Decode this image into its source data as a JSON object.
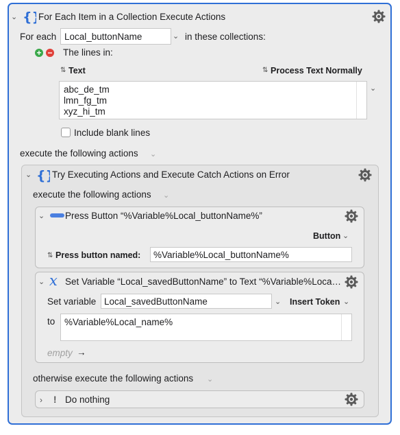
{
  "for_each": {
    "title": "For Each Item in a Collection Execute Actions",
    "for_each_label": "For each",
    "variable_value": "Local_buttonName",
    "in_collections_label": "in these collections:",
    "lines_in_label": "The lines in:",
    "text_header": "Text",
    "process_text_label": "Process Text Normally",
    "lines": [
      "abc_de_tm",
      "lmn_fg_tm",
      "xyz_hi_tm"
    ],
    "include_blank_label": "Include blank lines",
    "execute_label": "execute the following actions"
  },
  "try_block": {
    "title": "Try Executing Actions and Execute Catch Actions on Error",
    "execute_label": "execute the following actions",
    "otherwise_label": "otherwise execute the following actions"
  },
  "press_button": {
    "title": "Press Button “%Variable%Local_buttonName%”",
    "button_menu_label": "Button",
    "press_named_label": "Press button named:",
    "press_named_value": "%Variable%Local_buttonName%"
  },
  "set_variable": {
    "title": "Set Variable “Local_savedButtonName” to Text “%Variable%Loca…",
    "set_label": "Set variable",
    "variable_value": "Local_savedButtonName",
    "insert_token_label": "Insert Token",
    "to_label": "to",
    "to_value": "%Variable%Local_name%",
    "empty_label": "empty",
    "arrow": "→"
  },
  "do_nothing": {
    "title": "Do nothing",
    "icon_glyph": "!"
  },
  "colors": {
    "accent": "#2f6fd6",
    "add": "#3aa84a",
    "remove": "#e0413a"
  }
}
